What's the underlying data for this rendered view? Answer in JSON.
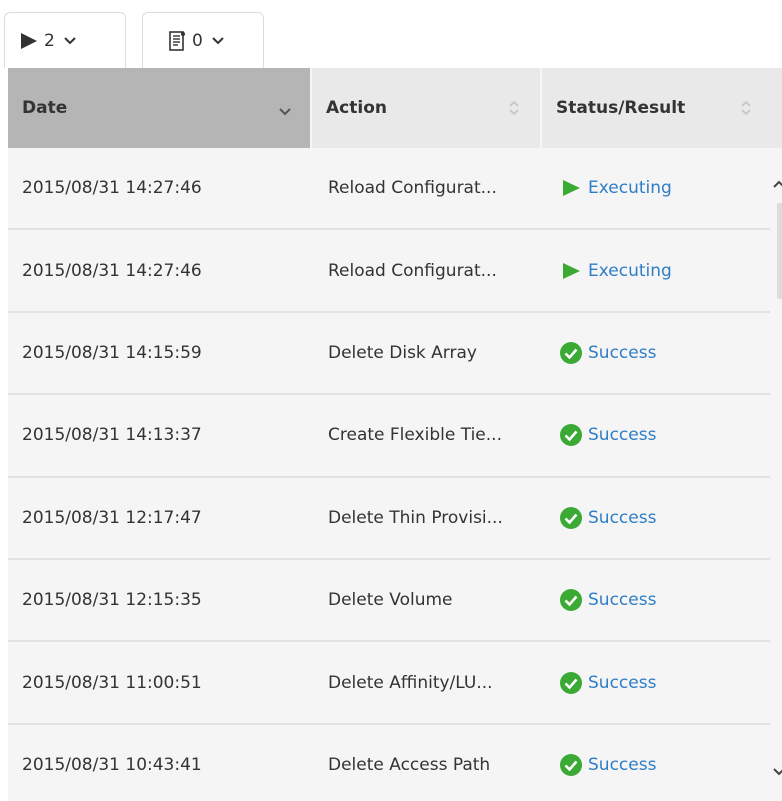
{
  "filters": {
    "executing_count": "2",
    "log_count": "0"
  },
  "columns": {
    "date": "Date",
    "action": "Action",
    "status": "Status/Result"
  },
  "rows": [
    {
      "date": "2015/08/31 14:27:46",
      "action": "Reload Configurat...",
      "status": "Executing",
      "status_type": "executing"
    },
    {
      "date": "2015/08/31 14:27:46",
      "action": "Reload Configurat...",
      "status": "Executing",
      "status_type": "executing"
    },
    {
      "date": "2015/08/31 14:15:59",
      "action": "Delete Disk Array",
      "status": "Success",
      "status_type": "success"
    },
    {
      "date": "2015/08/31 14:13:37",
      "action": "Create Flexible Tie...",
      "status": "Success",
      "status_type": "success"
    },
    {
      "date": "2015/08/31 12:17:47",
      "action": "Delete Thin Provisi...",
      "status": "Success",
      "status_type": "success"
    },
    {
      "date": "2015/08/31 12:15:35",
      "action": "Delete Volume",
      "status": "Success",
      "status_type": "success"
    },
    {
      "date": "2015/08/31 11:00:51",
      "action": "Delete Affinity/LU...",
      "status": "Success",
      "status_type": "success"
    },
    {
      "date": "2015/08/31 10:43:41",
      "action": "Delete Access Path",
      "status": "Success",
      "status_type": "success"
    }
  ],
  "colors": {
    "success": "#3aaa35",
    "executing": "#3aaa35",
    "link": "#2e7dc7"
  },
  "icons": {
    "executing": "play-icon",
    "success": "check-circle-icon",
    "log": "document-icon"
  }
}
